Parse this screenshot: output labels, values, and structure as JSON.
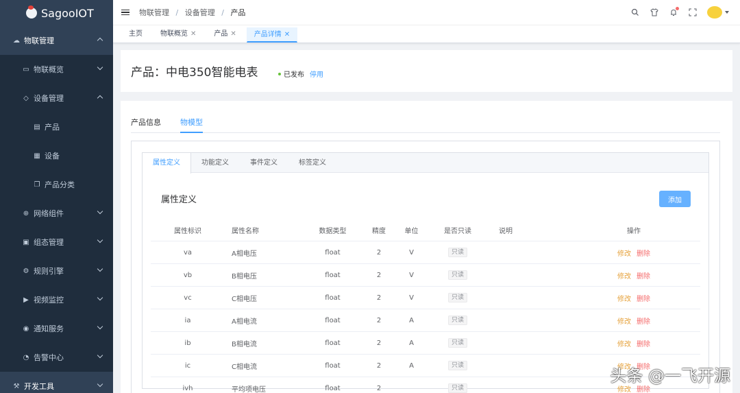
{
  "app": {
    "title": "SagooIOT"
  },
  "sidebar": {
    "items": [
      {
        "label": "物联管理",
        "icon": "cloud-icon",
        "level": 1,
        "expanded": true
      },
      {
        "label": "物联概览",
        "icon": "monitor-icon",
        "level": 2
      },
      {
        "label": "设备管理",
        "icon": "devices-icon",
        "level": 2,
        "expanded": true
      },
      {
        "label": "产品",
        "icon": "product-icon",
        "level": 3
      },
      {
        "label": "设备",
        "icon": "device-icon",
        "level": 3
      },
      {
        "label": "产品分类",
        "icon": "category-icon",
        "level": 3
      },
      {
        "label": "网络组件",
        "icon": "network-icon",
        "level": 2
      },
      {
        "label": "组态管理",
        "icon": "config-icon",
        "level": 2
      },
      {
        "label": "规则引擎",
        "icon": "rule-icon",
        "level": 2
      },
      {
        "label": "视频监控",
        "icon": "video-icon",
        "level": 2
      },
      {
        "label": "通知服务",
        "icon": "notify-icon",
        "level": 2
      },
      {
        "label": "告警中心",
        "icon": "alarm-icon",
        "level": 2
      },
      {
        "label": "开发工具",
        "icon": "dev-tools-icon",
        "level": 1
      }
    ]
  },
  "breadcrumb": [
    "物联管理",
    "设备管理",
    "产品"
  ],
  "tags": [
    {
      "label": "主页",
      "closable": false,
      "active": false
    },
    {
      "label": "物联概览",
      "closable": true,
      "active": false
    },
    {
      "label": "产品",
      "closable": true,
      "active": false
    },
    {
      "label": "产品详情",
      "closable": true,
      "active": true
    }
  ],
  "product": {
    "title": "产品：中电350智能电表",
    "status": "已发布",
    "disable_label": "停用"
  },
  "top_tabs": {
    "info": "产品信息",
    "model": "物模型"
  },
  "sub_tabs": [
    "属性定义",
    "功能定义",
    "事件定义",
    "标签定义"
  ],
  "section": {
    "title": "属性定义",
    "add_label": "添加"
  },
  "table": {
    "headers": [
      "属性标识",
      "属性名称",
      "数据类型",
      "精度",
      "单位",
      "是否只读",
      "说明",
      "操作"
    ],
    "rows": [
      {
        "key": "va",
        "name": "A相电压",
        "type": "float",
        "precision": "2",
        "unit": "V",
        "readonly": "只读",
        "desc": "",
        "edit": "修改",
        "del": "删除"
      },
      {
        "key": "vb",
        "name": "B相电压",
        "type": "float",
        "precision": "2",
        "unit": "V",
        "readonly": "只读",
        "desc": "",
        "edit": "修改",
        "del": "删除"
      },
      {
        "key": "vc",
        "name": "C相电压",
        "type": "float",
        "precision": "2",
        "unit": "V",
        "readonly": "只读",
        "desc": "",
        "edit": "修改",
        "del": "删除"
      },
      {
        "key": "ia",
        "name": "A相电流",
        "type": "float",
        "precision": "2",
        "unit": "A",
        "readonly": "只读",
        "desc": "",
        "edit": "修改",
        "del": "删除"
      },
      {
        "key": "ib",
        "name": "B相电流",
        "type": "float",
        "precision": "2",
        "unit": "A",
        "readonly": "只读",
        "desc": "",
        "edit": "修改",
        "del": "删除"
      },
      {
        "key": "ic",
        "name": "C相电流",
        "type": "float",
        "precision": "2",
        "unit": "A",
        "readonly": "只读",
        "desc": "",
        "edit": "修改",
        "del": "删除"
      },
      {
        "key": "ivh",
        "name": "平均项电压",
        "type": "float",
        "precision": "2",
        "unit": "",
        "readonly": "只读",
        "desc": "",
        "edit": "修改",
        "del": "删除"
      }
    ]
  },
  "watermark": "头条 @一飞开源"
}
